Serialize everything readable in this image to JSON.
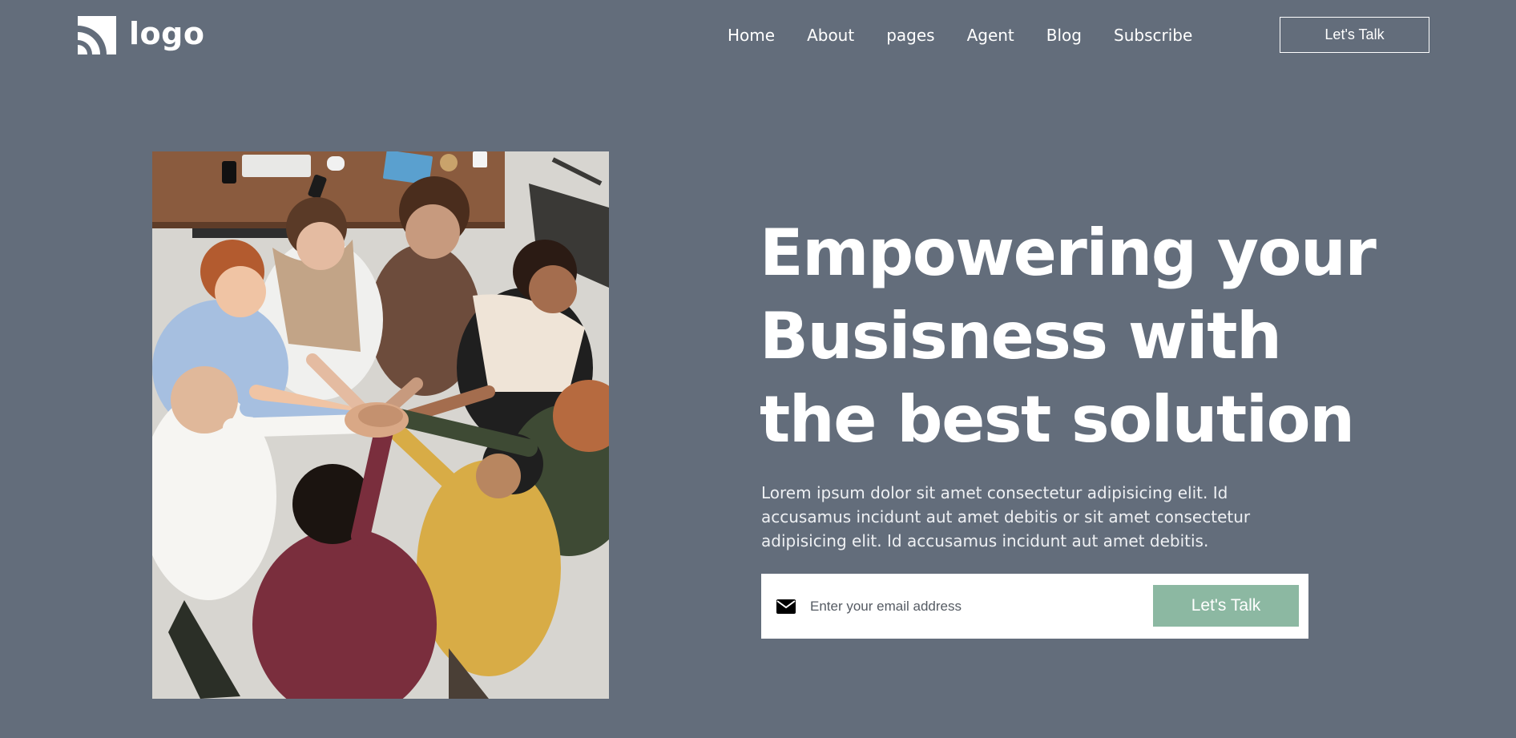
{
  "header": {
    "logo_text": "logo",
    "logo_icon": "signal-arcs-icon",
    "nav": [
      {
        "label": "Home"
      },
      {
        "label": "About"
      },
      {
        "label": "pages"
      },
      {
        "label": "Agent"
      },
      {
        "label": "Blog"
      },
      {
        "label": "Subscribe"
      }
    ],
    "cta_label": "Let's Talk"
  },
  "hero": {
    "title_lines": [
      "Empowering your",
      "Busisness with",
      "the best solution"
    ],
    "description": "Lorem ipsum dolor sit amet consectetur adipisicing elit. Id accusamus incidunt aut amet debitis or sit amet consectetur adipisicing elit. Id accusamus incidunt aut amet debitis.",
    "photo_icon": "team-hands-together-photo"
  },
  "subscribe": {
    "icon": "envelope-icon",
    "email_placeholder": "Enter your email address",
    "email_value": "",
    "button_label": "Let's Talk"
  },
  "colors": {
    "background": "#636d7b",
    "accent_button": "#8cb8a2",
    "text": "#ffffff"
  }
}
